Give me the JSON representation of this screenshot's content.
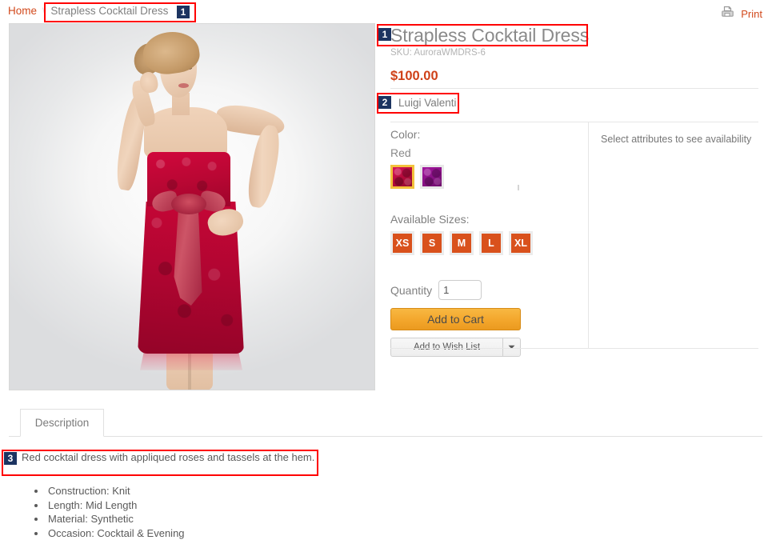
{
  "breadcrumb": {
    "home_label": "Home",
    "separator": "\\",
    "current_label": "Strapless Cocktail Dress"
  },
  "print": {
    "label": "Print",
    "icon": "printer-icon"
  },
  "product": {
    "title": "Strapless Cocktail Dress",
    "sku_label": "SKU: AuroraWMDRS-6",
    "price": "$100.00",
    "brand": "Luigi Valenti",
    "image_alt": "Model wearing red strapless cocktail dress with rose applique and bow"
  },
  "attributes": {
    "color_label": "Color:",
    "selected_color": "Red",
    "color_options": [
      {
        "name": "Red",
        "selected": true,
        "swatch_class": "sw-red"
      },
      {
        "name": "Purple",
        "selected": false,
        "swatch_class": "sw-purple"
      }
    ],
    "sizes_label": "Available Sizes:",
    "size_options": [
      "XS",
      "S",
      "M",
      "L",
      "XL"
    ]
  },
  "purchase": {
    "quantity_label": "Quantity",
    "quantity_value": "1",
    "quantity_placeholder": "1",
    "add_to_cart_label": "Add to Cart",
    "add_to_wishlist_label": "Add to Wish List",
    "wishlist_caret_icon": "chevron-down-icon"
  },
  "availability": {
    "message": "Select attributes to see availability"
  },
  "tabs": [
    {
      "label": "Description",
      "active": true
    }
  ],
  "description": {
    "text": "Red cocktail dress with appliqued roses and tassels at the hem.",
    "specs": [
      "Construction: Knit",
      "Length: Mid Length",
      "Material: Synthetic",
      "Occasion: Cocktail & Evening"
    ]
  },
  "annotations": [
    {
      "number": "1",
      "target": "breadcrumb-current"
    },
    {
      "number": "1",
      "target": "product-title"
    },
    {
      "number": "2",
      "target": "product-brand"
    },
    {
      "number": "3",
      "target": "description-text"
    }
  ],
  "colors": {
    "link": "#d2491c",
    "price": "#cf4118",
    "title": "#8a8a8a",
    "badge_bg": "#1c3461",
    "annotation_border": "#ff0000",
    "size_swatch": "#d9511c",
    "cart_button": "#f3a62c",
    "selected_swatch_border": "#f3c23c"
  }
}
